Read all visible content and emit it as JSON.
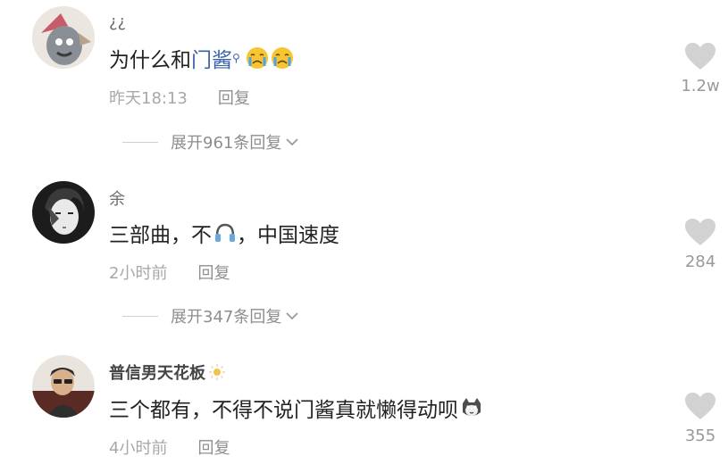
{
  "comments": [
    {
      "username": "¿¿",
      "text_prefix": "为什么和",
      "text_link": "门酱",
      "time": "昨天18:13",
      "reply": "回复",
      "likes": "1.2w",
      "expand": "展开961条回复",
      "emojis": [
        "crying-face-icon",
        "crying-face-icon"
      ]
    },
    {
      "username": "余",
      "text_a": "三部曲，不",
      "text_b": "，中国速度",
      "time": "2小时前",
      "reply": "回复",
      "likes": "284",
      "expand": "展开347条回复",
      "emojis": [
        "headphones-icon"
      ]
    },
    {
      "username": "普信男天花板",
      "text": "三个都有，不得不说门酱真就懒得动呗",
      "time": "4小时前",
      "reply": "回复",
      "likes": "355",
      "emojis": [
        "cat-face-icon"
      ]
    }
  ],
  "colors": {
    "link": "#3a62a8",
    "meta": "#a8a8a8",
    "heart": "#d2d2d2"
  }
}
